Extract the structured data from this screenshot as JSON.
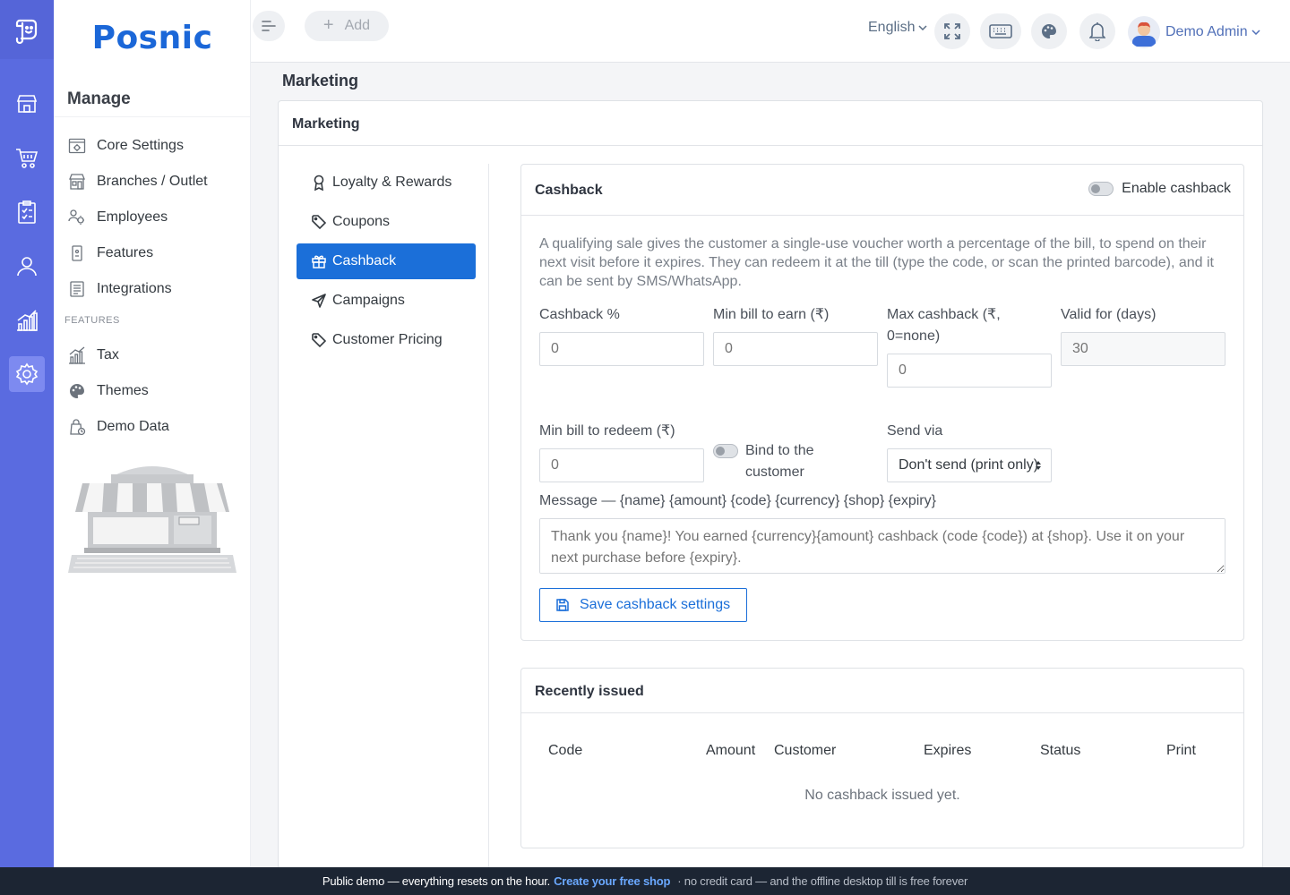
{
  "app": {
    "brand": "Posnic"
  },
  "rail": {
    "icons": [
      "logo-icon",
      "store-icon",
      "cart-icon",
      "clipboard-icon",
      "user-icon",
      "chart-icon",
      "settings-icon"
    ],
    "active": "settings-icon"
  },
  "sidebar": {
    "heading": "Manage",
    "items": [
      {
        "label": "Core Settings",
        "icon": "core-settings-icon"
      },
      {
        "label": "Branches / Outlet",
        "icon": "branches-icon"
      },
      {
        "label": "Employees",
        "icon": "employees-icon"
      },
      {
        "label": "Features",
        "icon": "features-icon"
      },
      {
        "label": "Integrations",
        "icon": "integrations-icon"
      }
    ],
    "section_label": "FEATURES",
    "feature_items": [
      {
        "label": "Tax",
        "icon": "tax-icon"
      },
      {
        "label": "Themes",
        "icon": "palette-icon"
      },
      {
        "label": "Demo Data",
        "icon": "demo-data-icon"
      }
    ]
  },
  "topbar": {
    "add_label": "Add",
    "language": "English",
    "user_name": "Demo Admin"
  },
  "page": {
    "title": "Marketing",
    "card_title": "Marketing"
  },
  "menu": {
    "items": [
      {
        "label": "Loyalty & Rewards",
        "icon": "award-icon"
      },
      {
        "label": "Coupons",
        "icon": "tag-icon"
      },
      {
        "label": "Cashback",
        "icon": "gift-icon"
      },
      {
        "label": "Campaigns",
        "icon": "send-icon"
      },
      {
        "label": "Customer Pricing",
        "icon": "tag-icon"
      }
    ],
    "active_index": 2
  },
  "cashback": {
    "title": "Cashback",
    "enable_label": "Enable cashback",
    "description": "A qualifying sale gives the customer a single-use voucher worth a percentage of the bill, to spend on their next visit before it expires. They can redeem it at the till (type the code, or scan the printed barcode), and it can be sent by SMS/WhatsApp.",
    "fields": {
      "percent": {
        "label": "Cashback %",
        "placeholder": "0"
      },
      "min_earn": {
        "label": "Min bill to earn (₹)",
        "placeholder": "0"
      },
      "max_cashback": {
        "label": "Max cashback (₹, 0=none)",
        "placeholder": "0"
      },
      "valid_days": {
        "label": "Valid for (days)",
        "placeholder": "30"
      },
      "min_redeem": {
        "label": "Min bill to redeem (₹)",
        "placeholder": "0"
      },
      "bind_customer": {
        "label": "Bind to the customer"
      },
      "send_via": {
        "label": "Send via",
        "value": "Don't send (print only)"
      },
      "message": {
        "label": "Message — {name} {amount} {code} {currency} {shop} {expiry}",
        "placeholder": "Thank you {name}! You earned {currency}{amount} cashback (code {code}) at {shop}. Use it on your next purchase before {expiry}."
      }
    },
    "save_label": "Save cashback settings"
  },
  "recent": {
    "title": "Recently issued",
    "columns": [
      "Code",
      "Amount",
      "Customer",
      "Expires",
      "Status",
      "Print"
    ],
    "empty_text": "No cashback issued yet."
  },
  "footer": {
    "text_before": "Public demo — everything resets on the hour.",
    "link": "Create your free shop",
    "text_after": "· no credit card — and the offline desktop till is free forever"
  },
  "colors": {
    "rail": "#5a6be0",
    "primary": "#1b6fd9",
    "brand": "#1b67d8",
    "footer": "#1c2533"
  }
}
